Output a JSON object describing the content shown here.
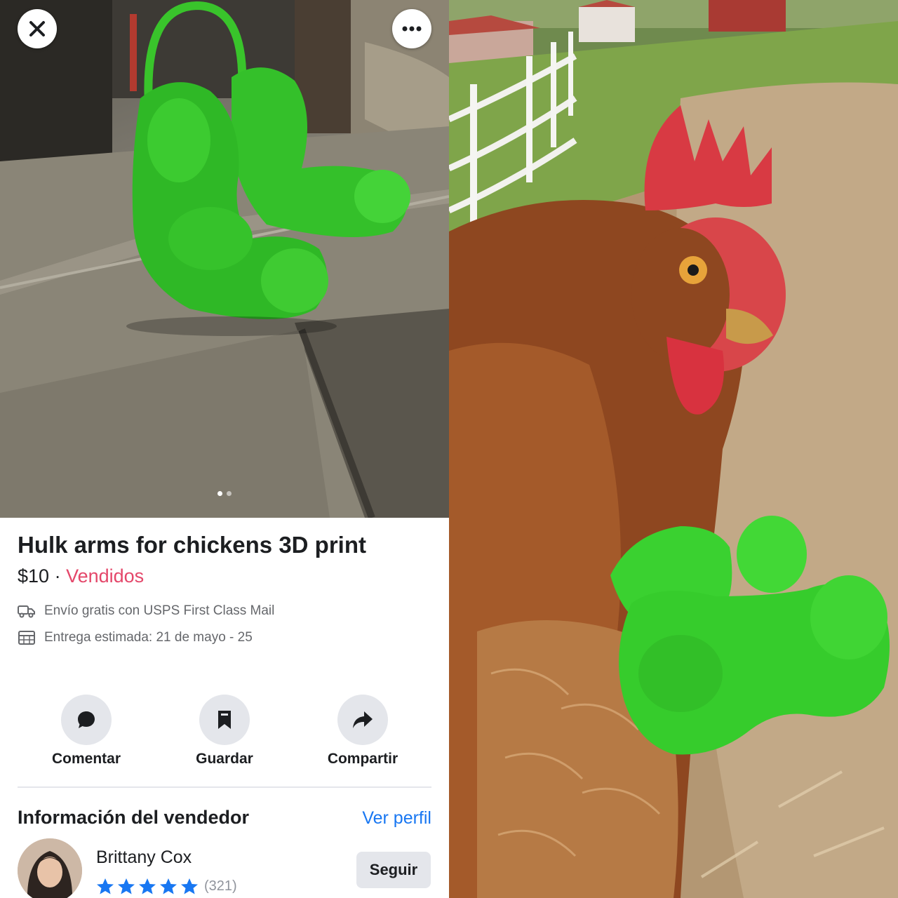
{
  "listing": {
    "title": "Hulk arms for chickens 3D print",
    "price": "$10",
    "separator": " · ",
    "status": "Vendidos",
    "shipping": "Envío gratis con USPS First Class Mail",
    "delivery": "Entrega estimada: 21 de mayo - 25",
    "photo_dots": {
      "count": 2,
      "active": 1
    }
  },
  "actions": {
    "comment_label": "Comentar",
    "save_label": "Guardar",
    "share_label": "Compartir"
  },
  "seller": {
    "heading": "Información del vendedor",
    "view_profile": "Ver perfil",
    "name": "Brittany Cox",
    "rating": 5,
    "rating_count": "(321)",
    "follow_label": "Seguir"
  },
  "colors": {
    "link": "#1877f2",
    "sold": "#e4476a",
    "button_bg": "#e4e6eb",
    "text": "#1c1e21",
    "muted": "#65676b",
    "print_green": "#3ad130"
  },
  "icons": {
    "close": "close-icon",
    "more": "more-dots-icon",
    "shipping": "truck-icon",
    "delivery": "calendar-icon",
    "comment": "speech-bubble-icon",
    "save": "bookmark-icon",
    "share": "share-arrow-icon",
    "star": "star-icon"
  }
}
